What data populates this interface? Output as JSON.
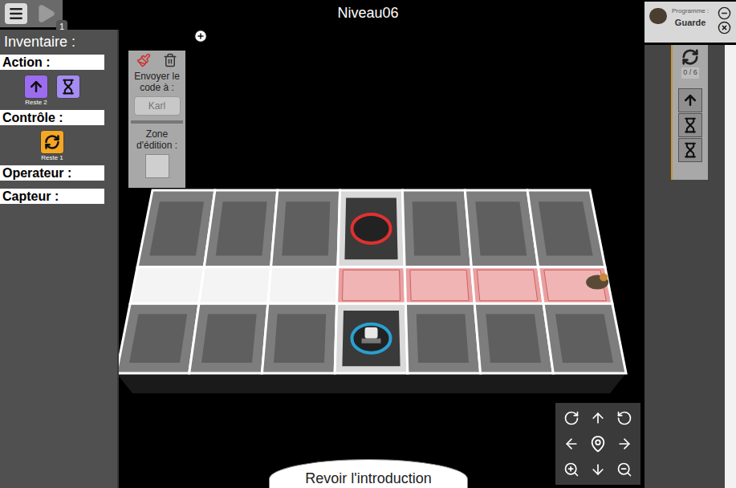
{
  "title": "Niveau06",
  "play_badge": "1",
  "inventory": {
    "title": "Inventaire :",
    "sections": [
      {
        "label": "Action :",
        "blocks": [
          {
            "kind": "forward",
            "remaining": "Reste 2",
            "color": "#9b6cf0"
          },
          {
            "kind": "wait",
            "color": "#a58cf2"
          }
        ]
      },
      {
        "label": "Contrôle :",
        "blocks": [
          {
            "kind": "loop",
            "remaining": "Reste 1",
            "color": "#f5a623"
          }
        ]
      },
      {
        "label": "Operateur :",
        "blocks": []
      },
      {
        "label": "Capteur :",
        "blocks": []
      }
    ]
  },
  "editor": {
    "send_label": "Envoyer le code à :",
    "recipient": "Karl",
    "zone_label": "Zone d'édition :"
  },
  "agent_card": {
    "label": "Programme :",
    "name": "Guarde"
  },
  "script": {
    "counter": "0 / 6",
    "blocks": [
      {
        "kind": "forward"
      },
      {
        "kind": "wait"
      },
      {
        "kind": "wait"
      }
    ]
  },
  "board": {
    "rows": [
      [
        "wall",
        "wall",
        "wall",
        "exit",
        "wall",
        "wall",
        "wall"
      ],
      [
        "floor",
        "floor",
        "floor",
        "detected",
        "detected",
        "detected",
        "detected"
      ],
      [
        "wall",
        "wall",
        "wall",
        "spawn",
        "wall",
        "wall",
        "wall"
      ]
    ],
    "units": [
      {
        "kind": "robot",
        "row": 2,
        "col": 3
      },
      {
        "kind": "guard",
        "row": 1,
        "col": 6
      }
    ]
  },
  "intro_button": "Revoir l'introduction"
}
